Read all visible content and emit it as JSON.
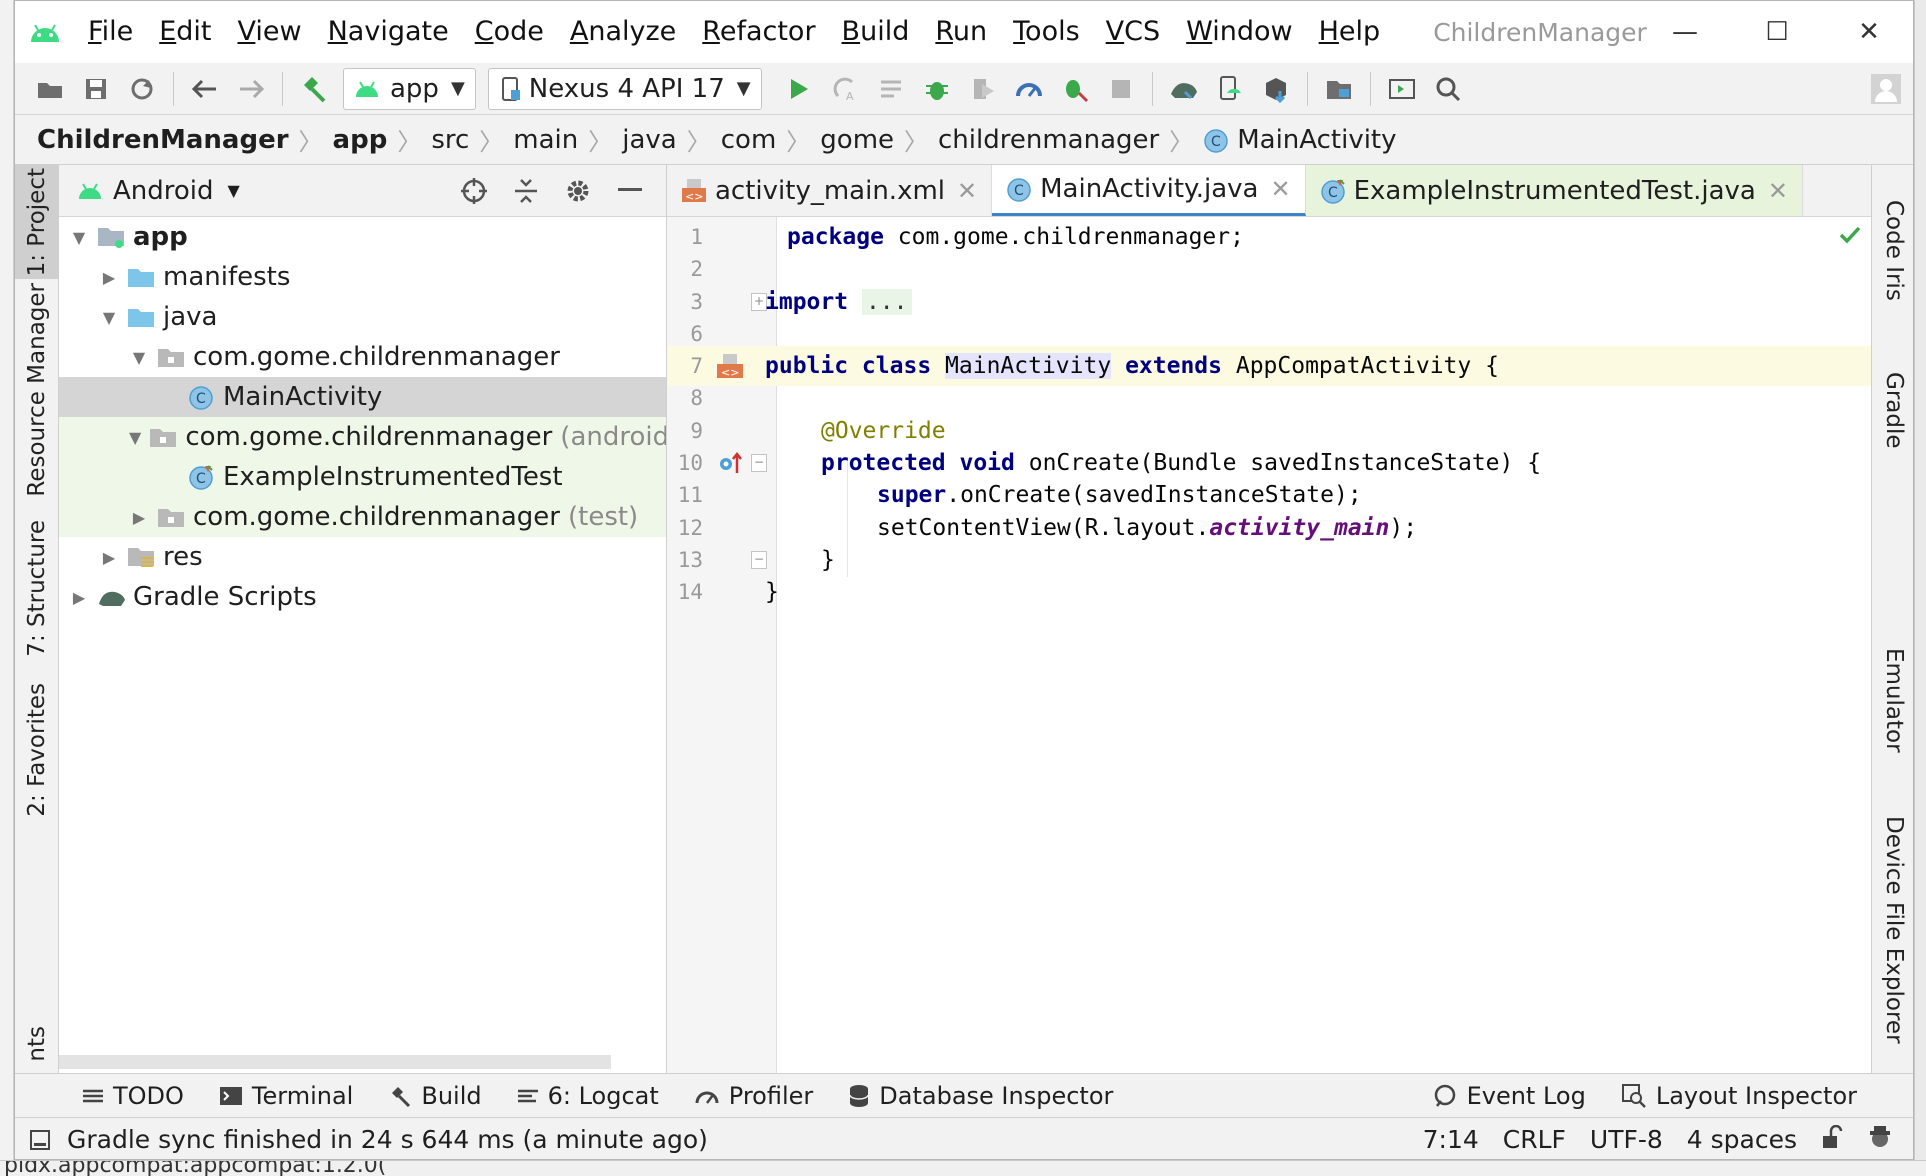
{
  "window": {
    "title": "ChildrenManager",
    "minimize": "—",
    "maximize": "☐",
    "close": "✕"
  },
  "menu": [
    {
      "label": "File",
      "mnemonic": "F",
      "rest": "ile"
    },
    {
      "label": "Edit",
      "mnemonic": "E",
      "rest": "dit"
    },
    {
      "label": "View",
      "mnemonic": "V",
      "rest": "iew"
    },
    {
      "label": "Navigate",
      "mnemonic": "N",
      "rest": "avigate"
    },
    {
      "label": "Code",
      "mnemonic": "C",
      "rest": "ode"
    },
    {
      "label": "Analyze",
      "mnemonic": "",
      "rest": "Analyze"
    },
    {
      "label": "Refactor",
      "mnemonic": "R",
      "rest": "efactor"
    },
    {
      "label": "Build",
      "mnemonic": "B",
      "rest": "uild"
    },
    {
      "label": "Run",
      "mnemonic": "",
      "rest": "Run"
    },
    {
      "label": "Tools",
      "mnemonic": "T",
      "rest": "ools"
    },
    {
      "label": "VCS",
      "mnemonic": "",
      "rest": "VCS"
    },
    {
      "label": "Window",
      "mnemonic": "W",
      "rest": "indow"
    },
    {
      "label": "Help",
      "mnemonic": "H",
      "rest": "elp"
    }
  ],
  "toolbar": {
    "run_config": "app",
    "device": "Nexus 4 API 17"
  },
  "breadcrumb": [
    {
      "label": "ChildrenManager",
      "bold": true
    },
    {
      "label": "app",
      "bold": true
    },
    {
      "label": "src",
      "bold": false
    },
    {
      "label": "main",
      "bold": false
    },
    {
      "label": "java",
      "bold": false
    },
    {
      "label": "com",
      "bold": false
    },
    {
      "label": "gome",
      "bold": false
    },
    {
      "label": "childrenmanager",
      "bold": false
    },
    {
      "label": "MainActivity",
      "bold": false,
      "icon": "class-icon"
    }
  ],
  "left_stripe": {
    "project": "1: Project",
    "resource_manager": "Resource Manager",
    "structure": "7: Structure",
    "favorites": "2: Favorites",
    "build_variants_partial": "nts"
  },
  "right_stripe": {
    "code_iris": "Code Iris",
    "gradle": "Gradle",
    "emulator": "Emulator",
    "device_file_explorer": "Device File Explorer"
  },
  "project_panel": {
    "view": "Android",
    "tree": [
      {
        "label": "app",
        "suffix": "",
        "level": 0,
        "state": "open",
        "icon": "module-icon",
        "bold": true
      },
      {
        "label": "manifests",
        "suffix": "",
        "level": 1,
        "state": "closed",
        "icon": "folder-icon"
      },
      {
        "label": "java",
        "suffix": "",
        "level": 1,
        "state": "open",
        "icon": "folder-icon"
      },
      {
        "label": "com.gome.childrenmanager",
        "suffix": "",
        "level": 2,
        "state": "open",
        "icon": "package-icon"
      },
      {
        "label": "MainActivity",
        "suffix": "",
        "level": 3,
        "state": "leaf",
        "icon": "class-icon",
        "selected": true
      },
      {
        "label": "com.gome.childrenmanager",
        "suffix": "(androidTe",
        "level": 2,
        "state": "open",
        "icon": "package-icon",
        "green": true
      },
      {
        "label": "ExampleInstrumentedTest",
        "suffix": "",
        "level": 3,
        "state": "leaf",
        "icon": "test-class-icon",
        "green": true
      },
      {
        "label": "com.gome.childrenmanager",
        "suffix": "(test)",
        "level": 2,
        "state": "closed",
        "icon": "package-icon",
        "green": true
      },
      {
        "label": "res",
        "suffix": "",
        "level": 1,
        "state": "closed",
        "icon": "res-folder-icon"
      },
      {
        "label": "Gradle Scripts",
        "suffix": "",
        "level": 0,
        "state": "closed",
        "icon": "gradle-icon"
      }
    ]
  },
  "editor": {
    "tabs": [
      {
        "label": "activity_main.xml",
        "icon": "xml-file-icon",
        "active": false,
        "test": false
      },
      {
        "label": "MainActivity.java",
        "icon": "class-icon",
        "active": true,
        "test": false
      },
      {
        "label": "ExampleInstrumentedTest.java",
        "icon": "test-class-icon",
        "active": false,
        "test": true
      }
    ],
    "line_numbers": [
      "1",
      "2",
      "3",
      "6",
      "7",
      "8",
      "9",
      "10",
      "11",
      "12",
      "13",
      "14"
    ],
    "code": {
      "l1_kw": "package",
      "l1_rest": " com.gome.childrenmanager;",
      "l3_kw": "import",
      "l3_dots": "...",
      "l7_kw1": "public class",
      "l7_name": "MainActivity",
      "l7_kw2": "extends",
      "l7_rest": " AppCompatActivity {",
      "l9_ann": "@Override",
      "l10_kw": "protected void",
      "l10_rest": " onCreate(Bundle savedInstanceState) {",
      "l11_kw": "super",
      "l11_rest": ".onCreate(savedInstanceState);",
      "l12_pre": "setContentView(R.layout.",
      "l12_field": "activity_main",
      "l12_post": ");",
      "l13": "}",
      "l14": "}"
    }
  },
  "bottom_tools": {
    "todo": "TODO",
    "terminal": "Terminal",
    "build": "Build",
    "logcat": "6: Logcat",
    "profiler": "Profiler",
    "database_inspector": "Database Inspector",
    "event_log": "Event Log",
    "layout_inspector": "Layout Inspector"
  },
  "status": {
    "message": "Gradle sync finished in 24 s 644 ms (a minute ago)",
    "position": "7:14",
    "line_sep": "CRLF",
    "encoding": "UTF-8",
    "indent": "4 spaces"
  },
  "background": {
    "bottom_text": "pidx.appcompat:appcompat:1.2.0("
  },
  "colors": {
    "android_green": "#3ddc84",
    "class_blue": "#4d9fd6",
    "keyword_navy": "#000080",
    "annotation_olive": "#808000",
    "field_purple": "#660e7a",
    "run_green": "#3aa84b",
    "folder_blue": "#7ec5ea"
  }
}
